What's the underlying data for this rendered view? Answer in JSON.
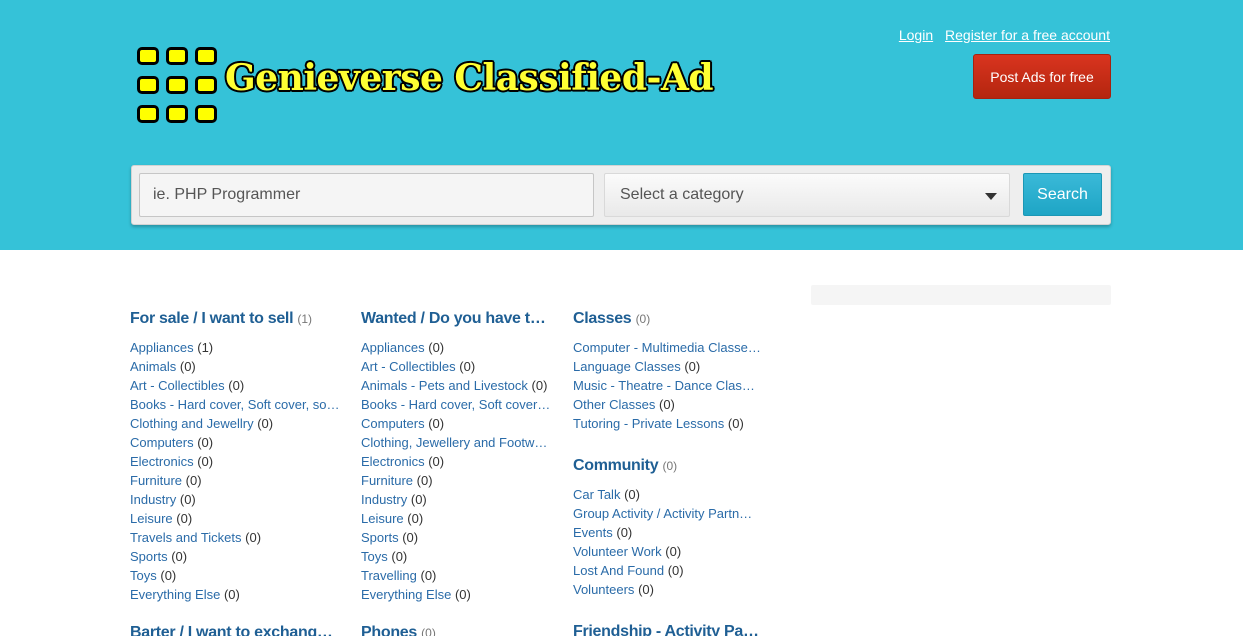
{
  "logo": {
    "text": "Genieverse Classified-Ad"
  },
  "top_links": {
    "login": "Login",
    "register": "Register for a free account"
  },
  "post_button": "Post Ads for free",
  "search": {
    "placeholder": "ie. PHP Programmer",
    "category_placeholder": "Select a category",
    "button": "Search"
  },
  "columns": [
    [
      {
        "title": "For sale / I want to sell",
        "count": "(1)",
        "items": [
          [
            "Appliances",
            "(1)"
          ],
          [
            "Animals",
            "(0)"
          ],
          [
            "Art - Collectibles",
            "(0)"
          ],
          [
            "Books - Hard cover, Soft cover, so…",
            ""
          ],
          [
            "Clothing and Jewellry",
            "(0)"
          ],
          [
            "Computers",
            "(0)"
          ],
          [
            "Electronics",
            "(0)"
          ],
          [
            "Furniture",
            "(0)"
          ],
          [
            "Industry",
            "(0)"
          ],
          [
            "Leisure",
            "(0)"
          ],
          [
            "Travels and Tickets",
            "(0)"
          ],
          [
            "Sports",
            "(0)"
          ],
          [
            "Toys",
            "(0)"
          ],
          [
            "Everything Else",
            "(0)"
          ]
        ]
      }
    ],
    [
      {
        "title": "Wanted / Do you have t…",
        "count": "",
        "items": [
          [
            "Appliances",
            "(0)"
          ],
          [
            "Art - Collectibles",
            "(0)"
          ],
          [
            "Animals - Pets and Livestock",
            "(0)"
          ],
          [
            "Books - Hard cover, Soft cover…",
            ""
          ],
          [
            "Computers",
            "(0)"
          ],
          [
            "Clothing, Jewellery and Footw…",
            ""
          ],
          [
            "Electronics",
            "(0)"
          ],
          [
            "Furniture",
            "(0)"
          ],
          [
            "Industry",
            "(0)"
          ],
          [
            "Leisure",
            "(0)"
          ],
          [
            "Sports",
            "(0)"
          ],
          [
            "Toys",
            "(0)"
          ],
          [
            "Travelling",
            "(0)"
          ],
          [
            "Everything Else",
            "(0)"
          ]
        ]
      }
    ],
    [
      {
        "title": "Classes",
        "count": "(0)",
        "items": [
          [
            "Computer - Multimedia Classe…",
            ""
          ],
          [
            "Language Classes",
            "(0)"
          ],
          [
            "Music - Theatre - Dance Clas…",
            ""
          ],
          [
            "Other Classes",
            "(0)"
          ],
          [
            "Tutoring - Private Lessons",
            "(0)"
          ]
        ]
      },
      {
        "title": "Community",
        "count": "(0)",
        "items": [
          [
            "Car Talk",
            "(0)"
          ],
          [
            "Group Activity / Activity Partn…",
            ""
          ],
          [
            "Events",
            "(0)"
          ],
          [
            "Volunteer Work",
            "(0)"
          ],
          [
            "Lost And Found",
            "(0)"
          ],
          [
            "Volunteers",
            "(0)"
          ]
        ]
      },
      {
        "title": "Friendship - Activity Pa…",
        "count": "",
        "items": []
      }
    ]
  ],
  "bottom_titles": {
    "col1": "Barter / I want to exchang…",
    "col2": "Phones",
    "col2_count": "(0)"
  }
}
